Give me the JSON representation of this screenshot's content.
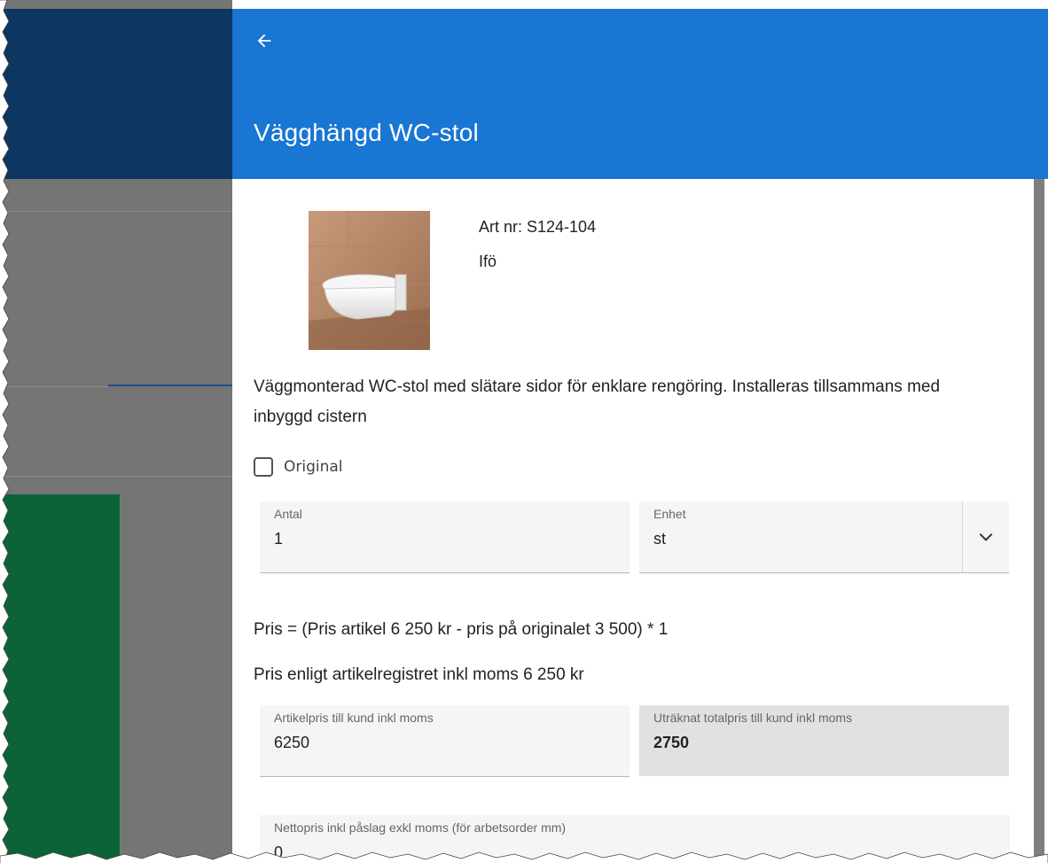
{
  "dialog": {
    "title": "Vägghängd WC-stol",
    "back_icon": "arrow-left-icon"
  },
  "product": {
    "art_nr": "Art nr: S124-104",
    "brand": "Ifö",
    "description": "Väggmonterad WC-stol med slätare sidor för enklare rengöring. Installeras tillsammans med inbyggd cistern"
  },
  "original": {
    "label": "Original",
    "checked": false
  },
  "quantity": {
    "label": "Antal",
    "value": "1"
  },
  "unit": {
    "label": "Enhet",
    "value": "st",
    "icon": "chevron-down-icon"
  },
  "pricing": {
    "formula": "Pris = (Pris artikel 6 250 kr - pris på originalet 3 500) * 1",
    "register_price": "Pris enligt artikelregistret inkl moms 6 250 kr"
  },
  "article_price": {
    "label": "Artikelpris till kund inkl moms",
    "value": "6250"
  },
  "total_price": {
    "label": "Uträknat totalpris till kund inkl moms",
    "value": "2750"
  },
  "net_price": {
    "label": "Nettopris inkl påslag exkl moms (för arbetsorder mm)",
    "value": "0"
  },
  "colors": {
    "header": "#1976d2",
    "background_header": "#0d3660",
    "background_green": "#0c6337",
    "readonly_field": "#e1e1e1"
  }
}
